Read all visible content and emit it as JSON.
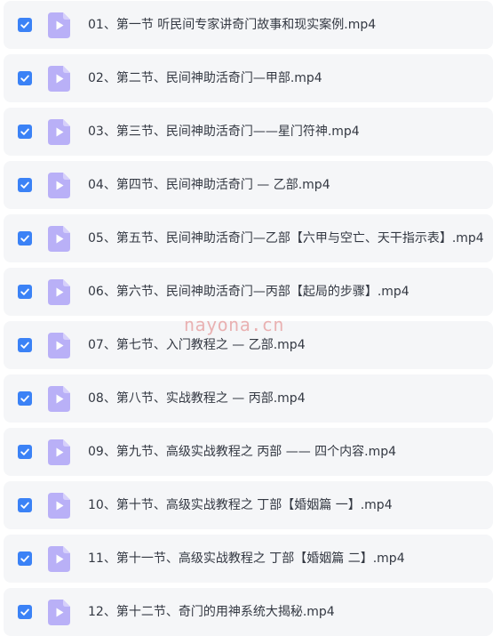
{
  "colors": {
    "checkbox": "#3b82f6",
    "file_icon": "#b9b0f7",
    "row_background": "#f5f6f8",
    "text": "#333842"
  },
  "icons": {
    "checkbox": "check-icon",
    "file": "video-file-icon"
  },
  "watermark": "nayona.cn",
  "files": [
    {
      "name": "01、第一节 听民间专家讲奇门故事和现实案例.mp4",
      "checked": true
    },
    {
      "name": "02、第二节、民间神助活奇门—甲部.mp4",
      "checked": true
    },
    {
      "name": "03、第三节、民间神助活奇门——星门符神.mp4",
      "checked": true
    },
    {
      "name": "04、第四节、民间神助活奇门 — 乙部.mp4",
      "checked": true
    },
    {
      "name": "05、第五节、民间神助活奇门—乙部【六甲与空亡、天干指示表】.mp4",
      "checked": true
    },
    {
      "name": "06、第六节、民间神助活奇门—丙部【起局的步骤】.mp4",
      "checked": true
    },
    {
      "name": "07、第七节、入门教程之 — 乙部.mp4",
      "checked": true
    },
    {
      "name": "08、第八节、实战教程之 — 丙部.mp4",
      "checked": true
    },
    {
      "name": "09、第九节、高级实战教程之 丙部 —— 四个内容.mp4",
      "checked": true
    },
    {
      "name": "10、第十节、高级实战教程之 丁部【婚姻篇 一】.mp4",
      "checked": true
    },
    {
      "name": "11、第十一节、高级实战教程之 丁部【婚姻篇 二】.mp4",
      "checked": true
    },
    {
      "name": "12、第十二节、奇门的用神系统大揭秘.mp4",
      "checked": true
    }
  ]
}
